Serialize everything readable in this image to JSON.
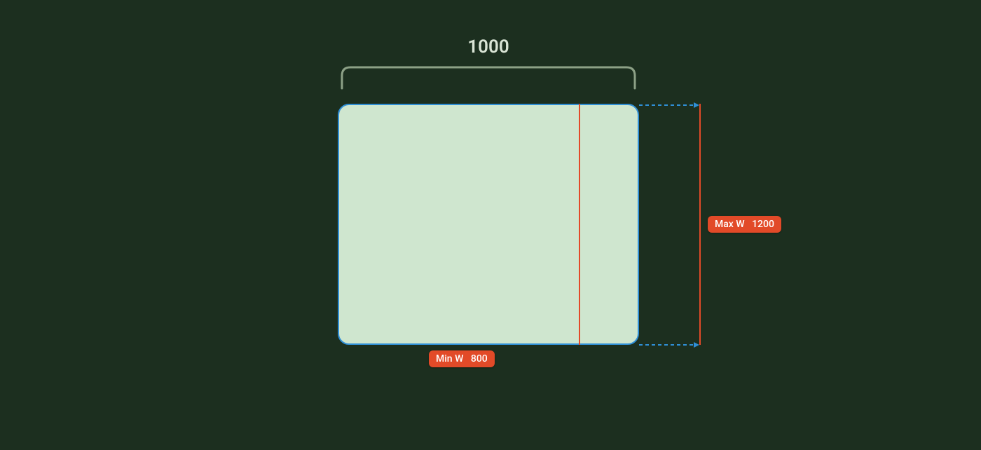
{
  "diagram": {
    "width_value": "1000",
    "min_w_label": "Min W",
    "min_w_value": "800",
    "max_w_label": "Max W",
    "max_w_value": "1200"
  },
  "colors": {
    "background": "#1c2f1f",
    "box_fill": "#cfe6cf",
    "box_border": "#2f8fd6",
    "marker": "#e24a28",
    "bracket": "#a9b9a6",
    "text": "#d9e4d5"
  }
}
